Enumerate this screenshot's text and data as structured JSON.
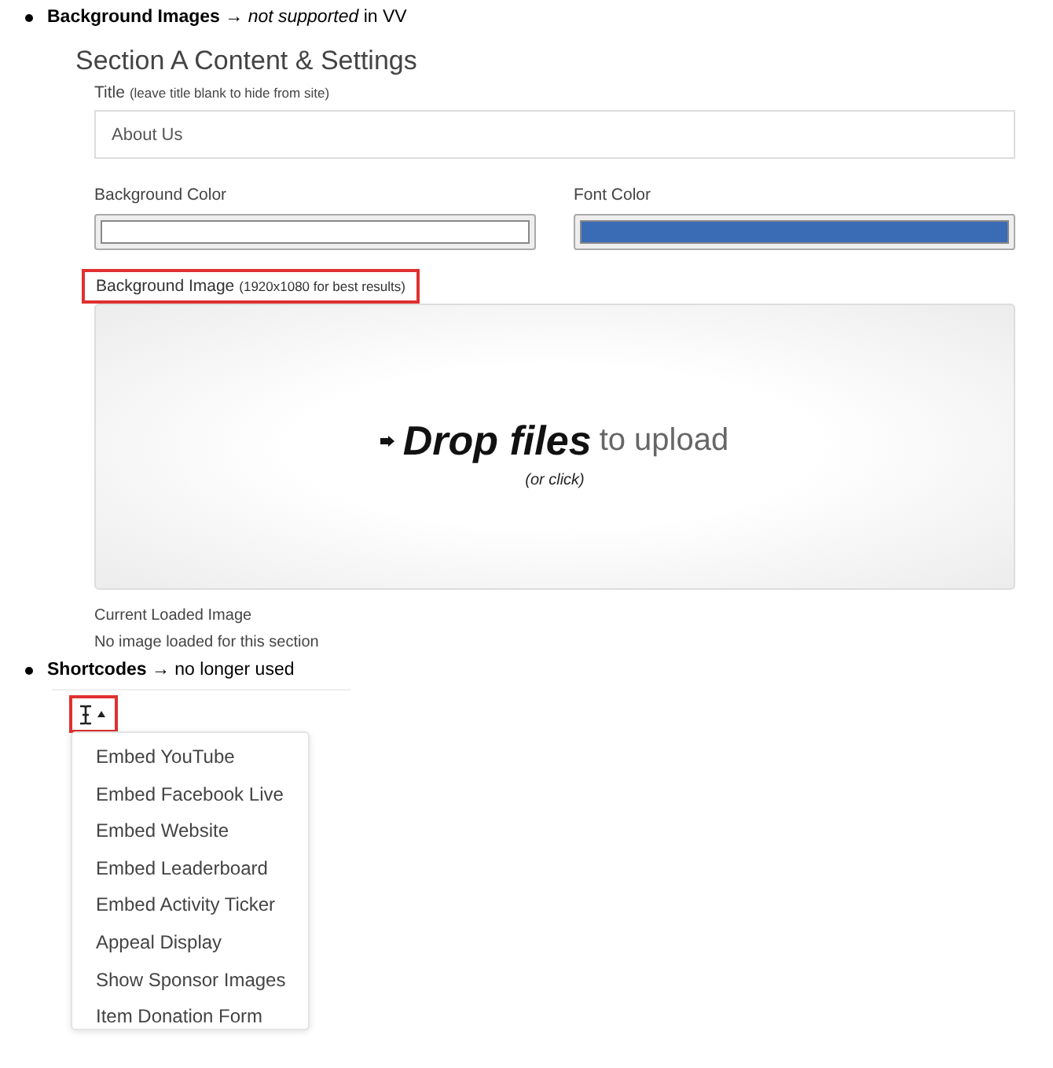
{
  "notes": [
    {
      "text": "**Background Images** → *not supported* in VV"
    },
    {
      "text": "**Shortcodes** → no longer used"
    }
  ],
  "section": {
    "heading": "Section A Content & Settings",
    "title_field": {
      "label": "Title",
      "hint": "(leave title blank to hide from site)",
      "value": "About Us"
    },
    "color_fields": [
      {
        "label": "Background Color",
        "color": "#ffffff"
      },
      {
        "label": "Font Color",
        "color": "#3a6bb5"
      }
    ],
    "image_field": {
      "label": "Background Image",
      "hint": "(1920x1080 for best results)",
      "highlighted": true
    },
    "dropzone": {
      "strong": "Drop files",
      "rest": "to upload",
      "hint": "(or click)"
    },
    "current_image": {
      "label": "Current Loaded Image",
      "value": "No image loaded for this section"
    }
  },
  "shortcodes": {
    "highlighted": true,
    "menu": [
      {
        "label": "Embed YouTube"
      },
      {
        "label": "Embed Facebook Live"
      },
      {
        "label": "Embed Website"
      },
      {
        "label": "Embed Leaderboard"
      },
      {
        "label": "Embed Activity Ticker"
      },
      {
        "label": "Appeal Display"
      },
      {
        "label": "Show Sponsor Images"
      },
      {
        "label": "Item Donation Form"
      }
    ]
  }
}
